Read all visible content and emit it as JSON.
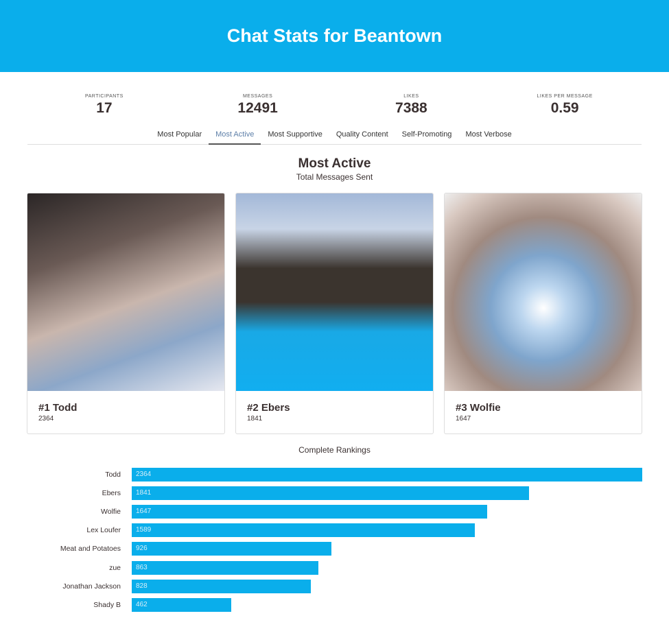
{
  "header": {
    "title": "Chat Stats for Beantown"
  },
  "stats": [
    {
      "label": "PARTICIPANTS",
      "value": "17"
    },
    {
      "label": "MESSAGES",
      "value": "12491"
    },
    {
      "label": "LIKES",
      "value": "7388"
    },
    {
      "label": "LIKES PER MESSAGE",
      "value": "0.59"
    }
  ],
  "tabs": [
    {
      "label": "Most Popular",
      "active": false
    },
    {
      "label": "Most Active",
      "active": true
    },
    {
      "label": "Most Supportive",
      "active": false
    },
    {
      "label": "Quality Content",
      "active": false
    },
    {
      "label": "Self-Promoting",
      "active": false
    },
    {
      "label": "Most Verbose",
      "active": false
    }
  ],
  "section": {
    "title": "Most Active",
    "subtitle": "Total Messages Sent"
  },
  "top3": [
    {
      "title": "#1 Todd",
      "value": "2364"
    },
    {
      "title": "#2 Ebers",
      "value": "1841"
    },
    {
      "title": "#3 Wolfie",
      "value": "1647"
    }
  ],
  "rankings_title": "Complete Rankings",
  "chart_data": {
    "type": "bar",
    "orientation": "horizontal",
    "categories": [
      "Todd",
      "Ebers",
      "Wolfie",
      "Lex Loufer",
      "Meat and Potatoes",
      "zue",
      "Jonathan Jackson",
      "Shady B"
    ],
    "values": [
      2364,
      1841,
      1647,
      1589,
      926,
      863,
      828,
      462
    ],
    "bar_color": "#0aaeeb"
  },
  "colors": {
    "accent": "#0aaeeb",
    "active_tab": "#5d7fa8"
  }
}
